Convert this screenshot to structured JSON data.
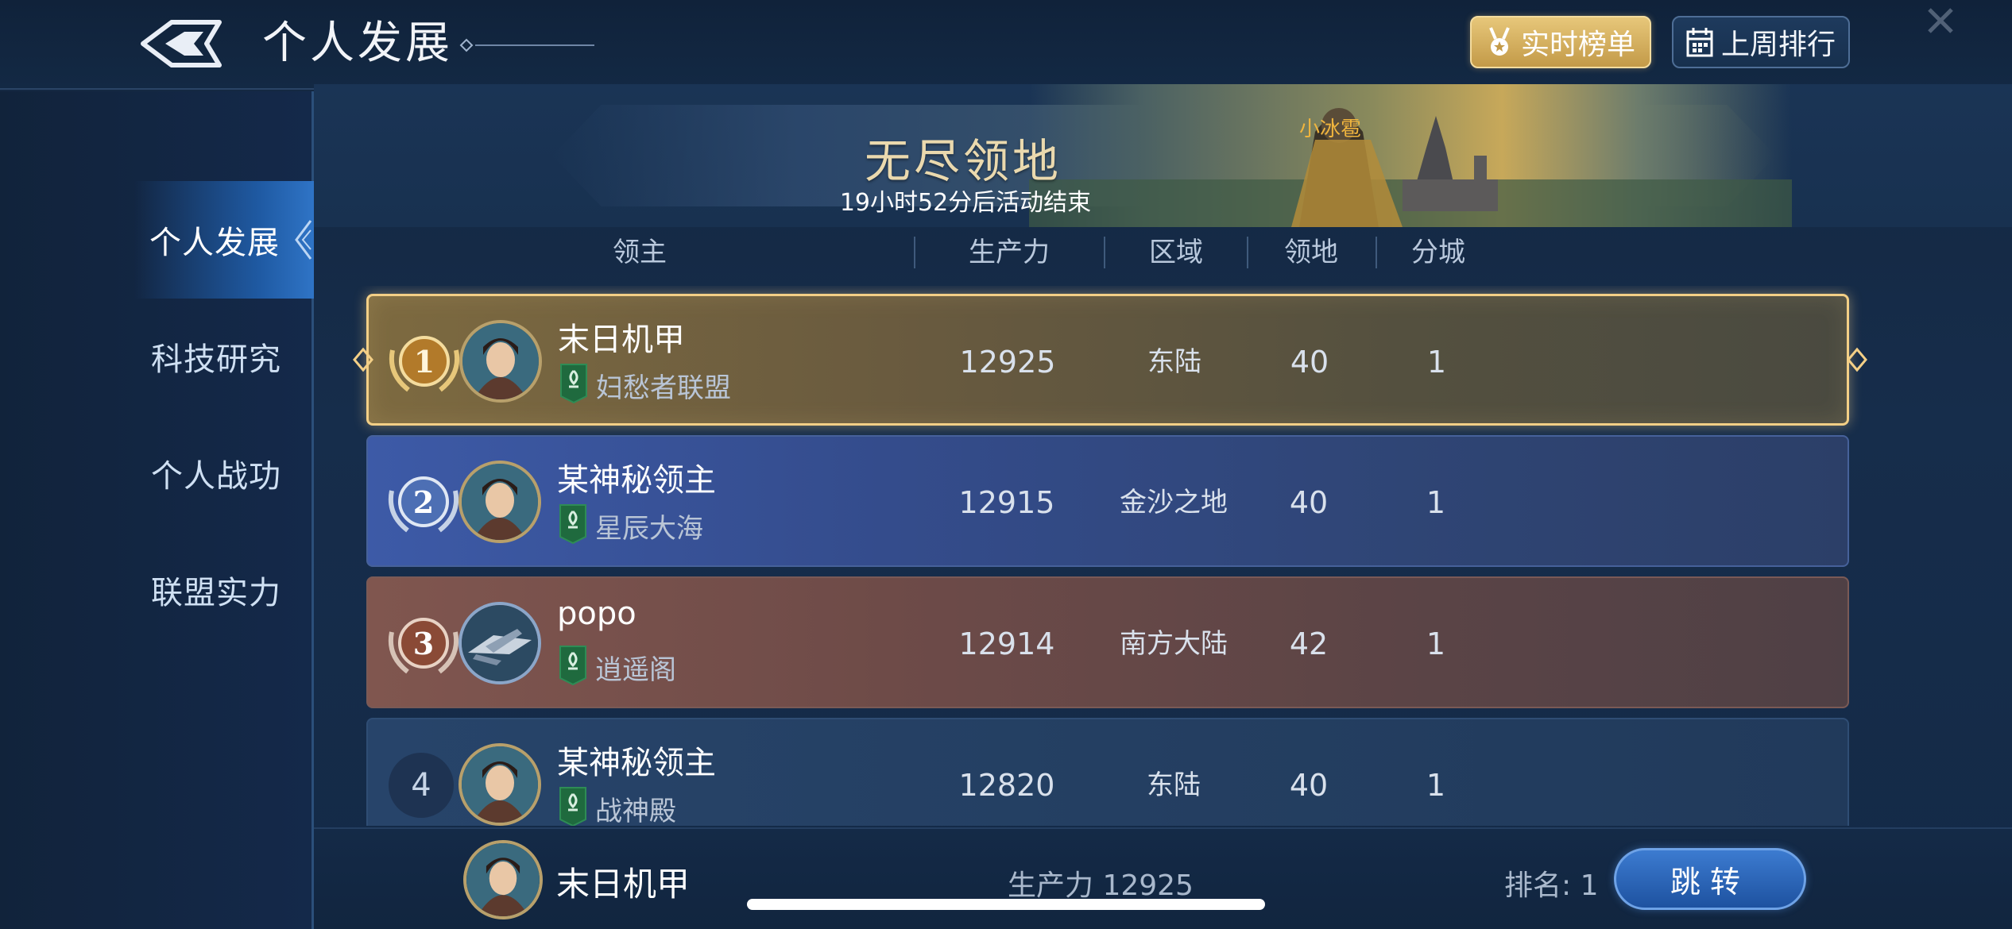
{
  "header": {
    "title": "个人发展",
    "live_button": "实时榜单",
    "lastweek_button": "上周排行"
  },
  "sidebar": {
    "items": [
      {
        "label": "个人发展",
        "active": true
      },
      {
        "label": "科技研究",
        "active": false
      },
      {
        "label": "个人战功",
        "active": false
      },
      {
        "label": "联盟实力",
        "active": false
      }
    ]
  },
  "banner": {
    "title": "无尽领地",
    "subtitle": "19小时52分后活动结束",
    "player_tag": "小冰雹"
  },
  "columns": {
    "lord": "领主",
    "power": "生产力",
    "region": "区域",
    "territory": "领地",
    "branch": "分城"
  },
  "rows": [
    {
      "rank": "1",
      "name": "末日机甲",
      "alliance": "妇愁者联盟",
      "power": "12925",
      "region": "东陆",
      "territory": "40",
      "branch": "1"
    },
    {
      "rank": "2",
      "name": "某神秘领主",
      "alliance": "星辰大海",
      "power": "12915",
      "region": "金沙之地",
      "territory": "40",
      "branch": "1"
    },
    {
      "rank": "3",
      "name": "popo",
      "alliance": "逍遥阁",
      "power": "12914",
      "region": "南方大陆",
      "territory": "42",
      "branch": "1"
    },
    {
      "rank": "4",
      "name": "某神秘领主",
      "alliance": "战神殿",
      "power": "12820",
      "region": "东陆",
      "territory": "40",
      "branch": "1"
    }
  ],
  "footer": {
    "my_name": "末日机甲",
    "power_text": "生产力  12925",
    "rank_text": "排名: 1",
    "jump_button": "跳转"
  },
  "colors": {
    "gold": "#f3cf86",
    "accent_blue": "#2f74c6",
    "banner_orange": "#f0b53e"
  }
}
